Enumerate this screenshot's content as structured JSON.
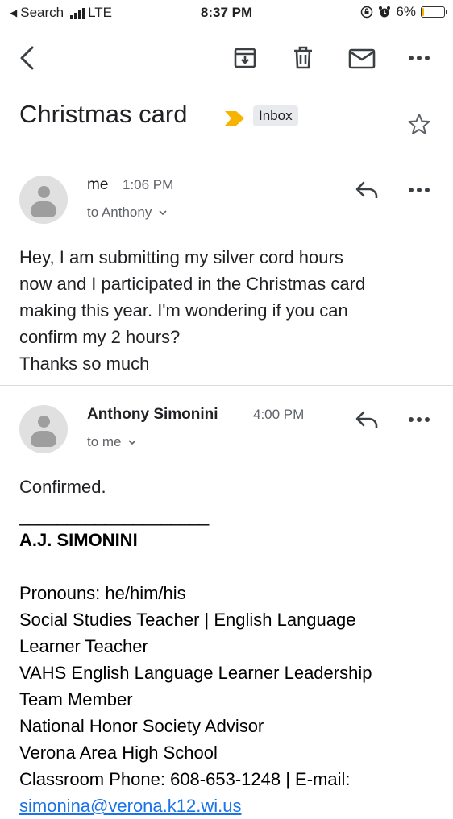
{
  "status_bar": {
    "back_app": "Search",
    "network": "LTE",
    "time": "8:37 PM",
    "battery": "6%",
    "battery_level": 0.06
  },
  "toolbar": {
    "icons": [
      "back-arrow-icon",
      "archive-icon",
      "delete-icon",
      "mail-icon",
      "more-icon"
    ]
  },
  "thread": {
    "subject": "Christmas card",
    "label": "Inbox",
    "important_color": "#f6b400"
  },
  "messages": [
    {
      "sender": "me",
      "time": "1:06 PM",
      "recipient": "to Anthony",
      "body": [
        "Hey, I am submitting my silver cord hours",
        "now and I participated in the Christmas card",
        "making this year. I'm wondering if you can",
        "confirm my 2 hours?",
        "Thanks so much"
      ]
    },
    {
      "sender": "Anthony Simonini",
      "time": "4:00 PM",
      "recipient": "to me",
      "body": [
        "Confirmed."
      ],
      "signature_rule": "____________________",
      "signature_name": "A.J. SIMONINI",
      "signature_lines": [
        "Pronouns: he/him/his",
        "Social Studies Teacher | English Language",
        "Learner Teacher",
        "VAHS English Language Learner Leadership",
        "Team Member",
        "National Honor Society Advisor",
        "Verona Area High School",
        "Classroom Phone: 608-653-1248 | E-mail:"
      ],
      "email_link": "simonina@verona.k12.wi.us"
    }
  ]
}
